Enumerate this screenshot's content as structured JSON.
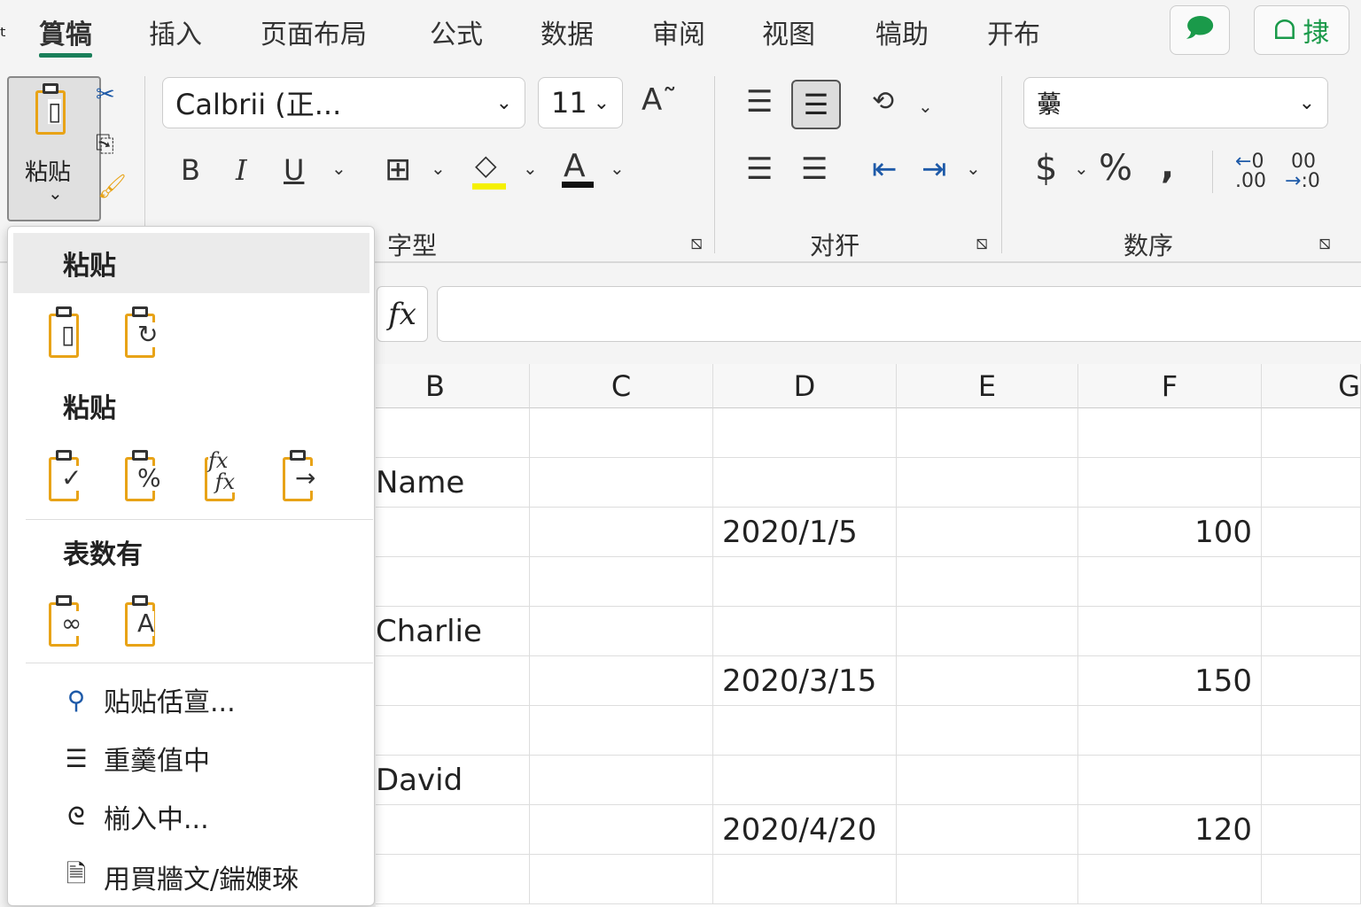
{
  "tabs": [
    "篔犒",
    "插入",
    "页面布局",
    "公式",
    "数据",
    "审阅",
    "视图",
    "犒助",
    "开布"
  ],
  "top_buttons": {
    "comment_icon": "comment-icon",
    "share_label": "捸"
  },
  "paste_button": {
    "label": "粘贴"
  },
  "font": {
    "name": "Calbrii (正...",
    "size": "11"
  },
  "number_format": "虆",
  "groups": {
    "font": "字型",
    "align": "对犴",
    "number": "数序"
  },
  "formula_bar": {
    "fx": "fx",
    "value": ""
  },
  "columns": [
    "B",
    "C",
    "D",
    "E",
    "F",
    "G"
  ],
  "rows": [
    {
      "b": "",
      "d": "",
      "f": ""
    },
    {
      "b": "Name",
      "d": "",
      "f": ""
    },
    {
      "b": "",
      "d": "2020/1/5",
      "f": "100"
    },
    {
      "b": "",
      "d": "",
      "f": ""
    },
    {
      "b": "Charlie",
      "d": "",
      "f": ""
    },
    {
      "b": "",
      "d": "2020/3/15",
      "f": "150"
    },
    {
      "b": "",
      "d": "",
      "f": ""
    },
    {
      "b": "David",
      "d": "",
      "f": ""
    },
    {
      "b": "",
      "d": "2020/4/20",
      "f": "120"
    },
    {
      "b": "",
      "d": "",
      "f": ""
    }
  ],
  "paste_menu": {
    "section1": "粘贴",
    "section2": "粘贴",
    "section3": "表数有",
    "items": [
      "贴贴佸亶...",
      "重羹值中",
      "椾入中...",
      "用買牆文/鍴㛹琜"
    ]
  },
  "colors": {
    "accent": "#1a7f5a",
    "clipboard": "#e8a317",
    "green": "#1a9a4a"
  }
}
